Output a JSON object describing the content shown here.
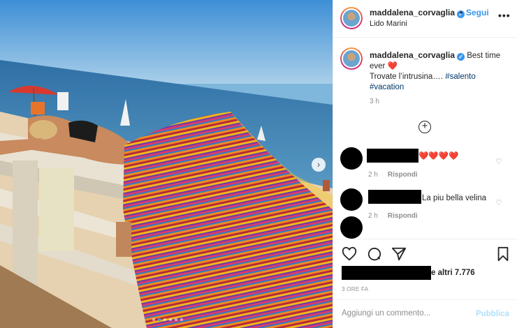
{
  "post": {
    "username": "maddalena_corvaglia",
    "follow_label": "Segui",
    "separator": "•",
    "location": "Lido Marini",
    "more_icon": "more-options-icon",
    "caption_line1": "Best time ever",
    "caption_heart": "❤️",
    "caption_line2": "Trovate l’intrusina….",
    "hashtags": [
      "#salento",
      "#vacation"
    ],
    "caption_time": "3 h"
  },
  "comments": [
    {
      "text": "❤️❤️❤️❤️",
      "time": "2 h",
      "reply_label": "Rispondi"
    },
    {
      "text": "La piu bella velina",
      "time": "2 h",
      "reply_label": "Rispondi"
    },
    {
      "text": ""
    }
  ],
  "actions": {
    "likes_text": "e altri 7.776",
    "post_age": "3 ORE FA",
    "comment_placeholder": "Aggiungi un commento...",
    "publish_label": "Pubblica"
  },
  "carousel": {
    "slides": 6,
    "active_index": 1
  },
  "colors": {
    "link": "#3897f0",
    "hashtag": "#003569",
    "heart": "#ed4956",
    "muted": "#8e8e8e"
  }
}
